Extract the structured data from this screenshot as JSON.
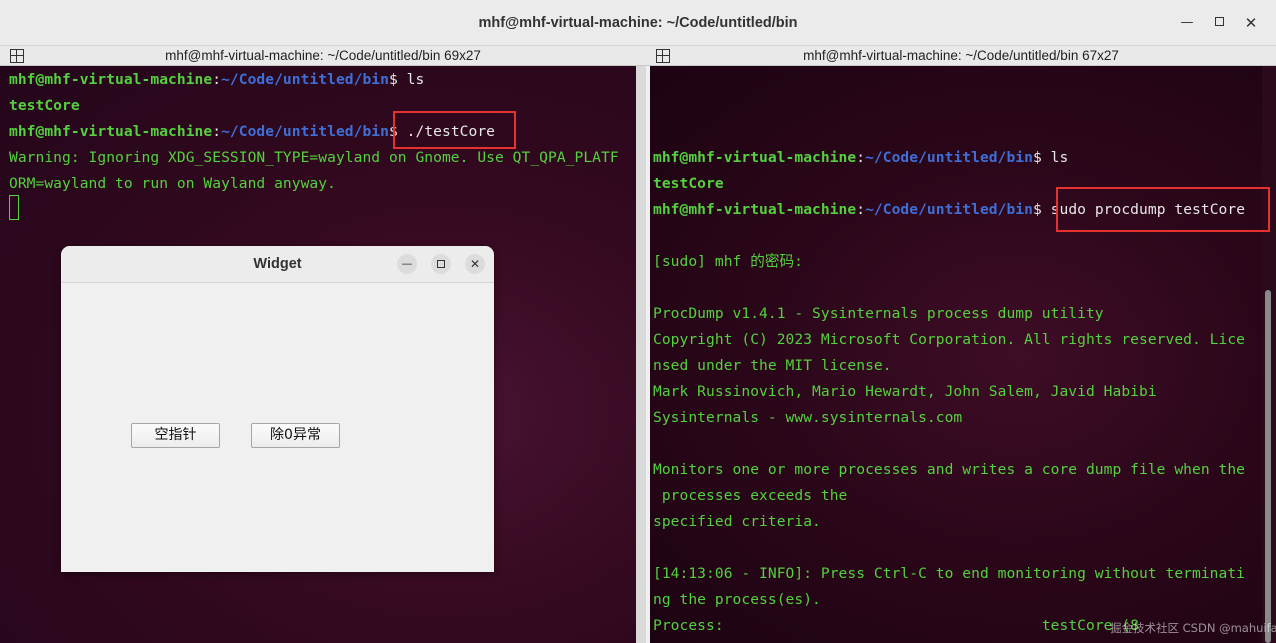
{
  "window": {
    "title": "mhf@mhf-virtual-machine: ~/Code/untitled/bin",
    "min_icon": "minimize-icon",
    "max_icon": "maximize-icon",
    "close_icon": "close-icon",
    "close_glyph": "✕",
    "min_glyph": "—"
  },
  "panes": {
    "left_title": "mhf@mhf-virtual-machine: ~/Code/untitled/bin 69x27",
    "right_title": "mhf@mhf-virtual-machine: ~/Code/untitled/bin 67x27"
  },
  "left_terminal": {
    "prompt_user": "mhf@mhf-virtual-machine",
    "prompt_path": "~/Code/untitled/bin",
    "prompt_end": "$ ",
    "cmd1": "ls",
    "out1": "testCore",
    "cmd2": "./testCore",
    "warn1": "Warning: Ignoring XDG_SESSION_TYPE=wayland on Gnome. Use QT_QPA_PLATF",
    "warn2": "ORM=wayland to run on Wayland anyway."
  },
  "right_terminal": {
    "prompt_user": "mhf@mhf-virtual-machine",
    "prompt_path": "~/Code/untitled/bin",
    "prompt_end": "$ ",
    "cmd1": "ls",
    "out1": "testCore",
    "cmd2": "sudo procdump testCore",
    "sudo_prompt": "[sudo] mhf 的密码:",
    "lines": [
      "ProcDump v1.4.1 - Sysinternals process dump utility",
      "Copyright (C) 2023 Microsoft Corporation. All rights reserved. Lice",
      "nsed under the MIT license.",
      "Mark Russinovich, Mario Hewardt, John Salem, Javid Habibi",
      "Sysinternals - www.sysinternals.com"
    ],
    "monitor_lines": [
      "Monitors one or more processes and writes a core dump file when the",
      " processes exceeds the",
      "specified criteria."
    ],
    "info_lines": [
      "[14:13:06 - INFO]: Press Ctrl-C to end monitoring without terminati",
      "ng the process(es)."
    ],
    "process_label": "Process:",
    "process_value": "testCore (8"
  },
  "widget": {
    "title": "Widget",
    "button1": "空指针",
    "button2": "除0异常",
    "min_glyph": "—",
    "close_glyph": "✕"
  },
  "watermark": "掘金技术社区 CSDN @mahuifa"
}
